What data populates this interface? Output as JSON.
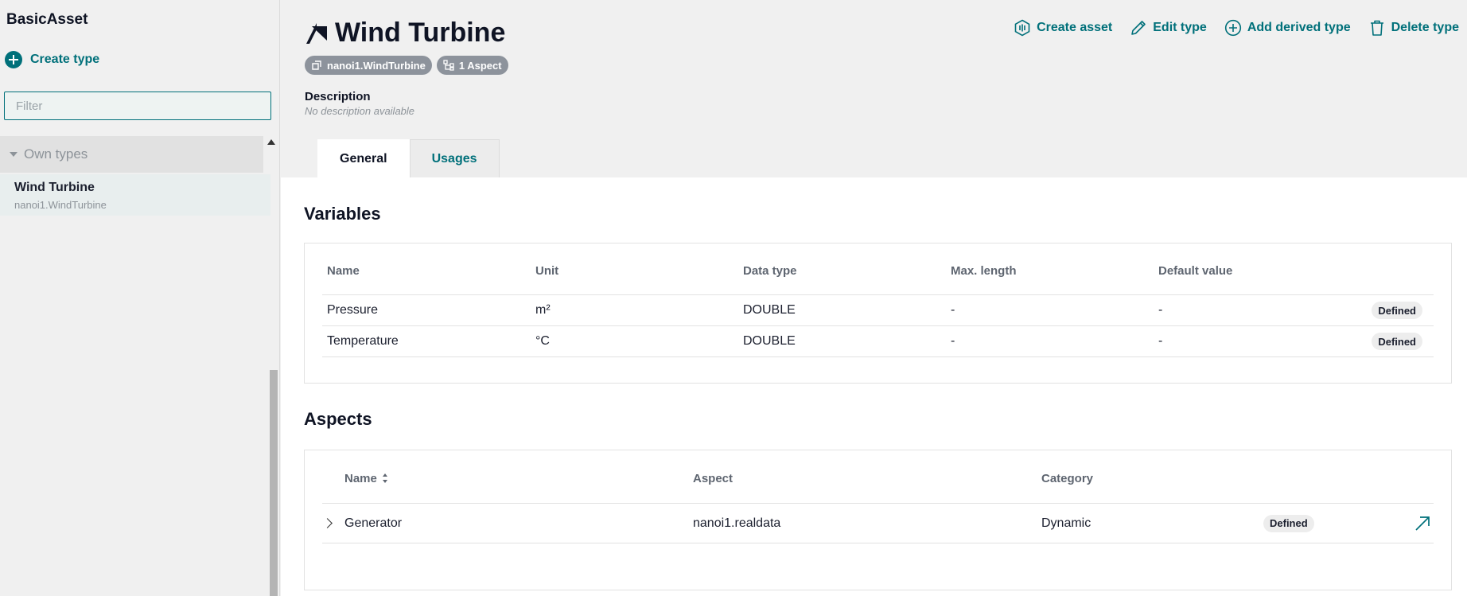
{
  "sidebar": {
    "title": "BasicAsset",
    "create_type_label": "Create type",
    "filter_placeholder": "Filter",
    "group_label": "Own types",
    "items": [
      {
        "name": "Wind Turbine",
        "id": "nanoi1.WindTurbine"
      }
    ]
  },
  "header": {
    "title": "Wind Turbine",
    "badges": {
      "type_id": "nanoi1.WindTurbine",
      "aspects": "1 Aspect"
    },
    "description_label": "Description",
    "description_text": "No description available",
    "actions": {
      "create_asset": "Create asset",
      "edit_type": "Edit type",
      "add_derived_type": "Add derived type",
      "delete_type": "Delete type"
    },
    "tabs": {
      "general": "General",
      "usages": "Usages"
    }
  },
  "variables": {
    "title": "Variables",
    "columns": {
      "name": "Name",
      "unit": "Unit",
      "data_type": "Data type",
      "max_length": "Max. length",
      "default_value": "Default value"
    },
    "rows": [
      {
        "name": "Pressure",
        "unit": "m²",
        "data_type": "DOUBLE",
        "max_length": "-",
        "default_value": "-",
        "status": "Defined"
      },
      {
        "name": "Temperature",
        "unit": "°C",
        "data_type": "DOUBLE",
        "max_length": "-",
        "default_value": "-",
        "status": "Defined"
      }
    ]
  },
  "aspects": {
    "title": "Aspects",
    "columns": {
      "name": "Name",
      "aspect": "Aspect",
      "category": "Category"
    },
    "rows": [
      {
        "name": "Generator",
        "aspect": "nanoi1.realdata",
        "category": "Dynamic",
        "status": "Defined"
      }
    ]
  },
  "colors": {
    "accent": "#00707a",
    "text": "#0f1424",
    "muted": "#8d9399"
  }
}
